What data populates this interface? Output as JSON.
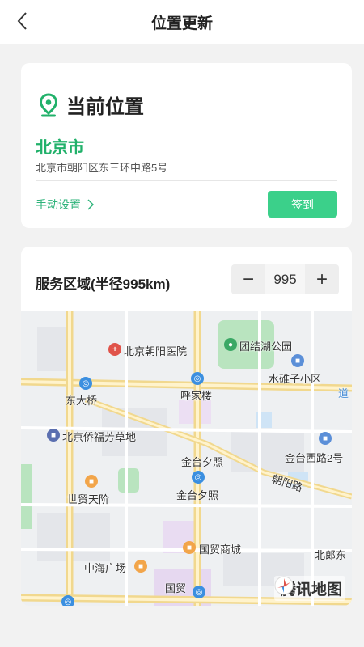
{
  "header": {
    "title": "位置更新",
    "back_icon": "chevron-left-icon"
  },
  "location": {
    "title": "当前位置",
    "city": "北京市",
    "address": "北京市朝阳区东三环中路5号",
    "manual_label": "手动设置",
    "checkin_label": "签到"
  },
  "service": {
    "label": "服务区域(半径995km)",
    "radius_value": "995",
    "minus": "−",
    "plus": "+"
  },
  "map": {
    "labels": {
      "hospital": "北京朝阳医院",
      "park": "团结湖公园",
      "shuiduizi": "水碓子小区",
      "dongdaqiao": "东大桥",
      "hujialou": "呼家楼",
      "overseas": "北京侨福芳草地",
      "jintaixizhao1": "金台夕照",
      "jintaixizhao2": "金台夕照",
      "jintaixilu": "金台西路2号",
      "chaoyanglu": "朝阳路",
      "shimaotianjie": "世贸天阶",
      "guomao_mall": "国贸商城",
      "zhonghai": "中海广场",
      "guomao": "国贸",
      "beilang": "北郎东",
      "dao": "道"
    },
    "logo_text": "腾讯地图"
  },
  "colors": {
    "accent": "#21b16a",
    "button": "#3bd08a"
  }
}
